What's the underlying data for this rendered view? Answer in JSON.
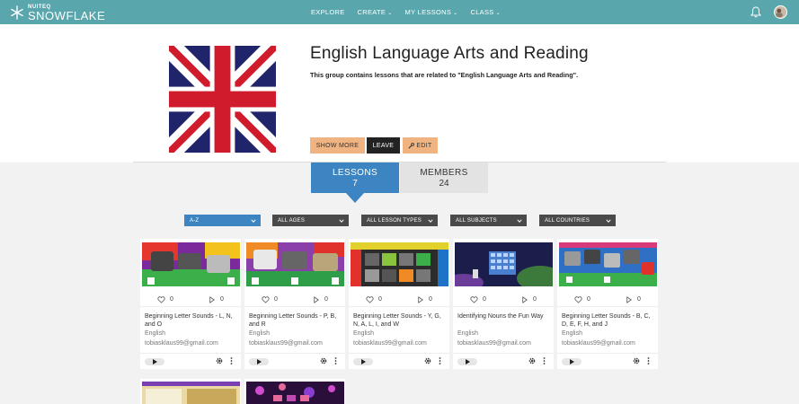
{
  "brand": {
    "small": "NUITEQ",
    "name": "SNOWFLAKE"
  },
  "nav": {
    "explore": "EXPLORE",
    "create": "CREATE",
    "my_lessons": "MY LESSONS",
    "class": "CLASS",
    "caret": "⌄"
  },
  "group": {
    "title": "English Language Arts and Reading",
    "description": "This group contains lessons that are related to \"English Language Arts and Reading\"."
  },
  "actions": {
    "show_more": "SHOW MORE",
    "leave": "LEAVE",
    "edit": "EDIT"
  },
  "tabs": {
    "lessons_label": "LESSONS",
    "lessons_count": "7",
    "members_label": "MEMBERS",
    "members_count": "24"
  },
  "filters": [
    "A-Z",
    "ALL AGES",
    "ALL LESSON TYPES",
    "ALL SUBJECTS",
    "ALL COUNTRIES"
  ],
  "lessons": [
    {
      "title": "Beginning Letter Sounds - L, N, and O",
      "subject": "English",
      "author": "tobiasklaus99@gmail.com",
      "likes": "0",
      "plays": "0"
    },
    {
      "title": "Beginning Letter Sounds - P, B, and R",
      "subject": "English",
      "author": "tobiasklaus99@gmail.com",
      "likes": "0",
      "plays": "0"
    },
    {
      "title": "Beginning Letter Sounds - Y, G, N, A, L, I, and W",
      "subject": "English",
      "author": "tobiasklaus99@gmail.com",
      "likes": "0",
      "plays": "0"
    },
    {
      "title": "Identifying Nouns the Fun Way",
      "subject": "English",
      "author": "tobiasklaus99@gmail.com",
      "likes": "0",
      "plays": "0"
    },
    {
      "title": "Beginning Letter Sounds - B, C, D, E, F, H, and J",
      "subject": "English",
      "author": "tobiasklaus99@gmail.com",
      "likes": "0",
      "plays": "0"
    }
  ],
  "colors": {
    "topbar": "#5aa6ad",
    "accent_blue": "#3c85c2",
    "peach_button": "#f0b482",
    "dark_button": "#222222"
  },
  "icons": [
    "snowflake-logo-icon",
    "bell-icon",
    "user-avatar",
    "wrench-icon",
    "chevron-down-icon",
    "heart-icon",
    "play-count-icon",
    "play-icon",
    "gear-icon",
    "more-vertical-icon"
  ]
}
